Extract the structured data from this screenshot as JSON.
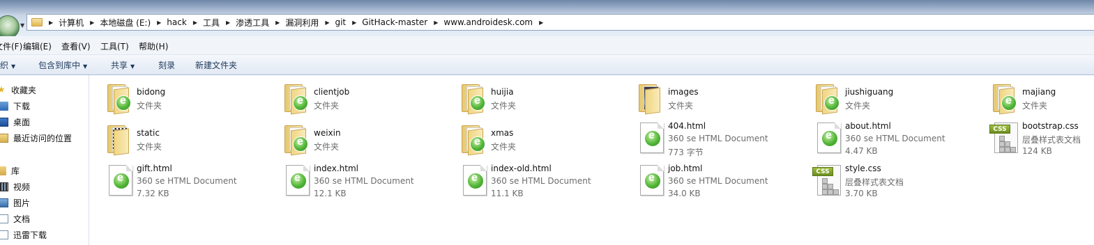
{
  "address_bar": {
    "breadcrumbs": [
      "计算机",
      "本地磁盘 (E:)",
      "hack",
      "工具",
      "渗透工具",
      "漏洞利用",
      "git",
      "GitHack-master",
      "www.androidesk.com"
    ]
  },
  "menu": [
    "文件(F)",
    "编辑(E)",
    "查看(V)",
    "工具(T)",
    "帮助(H)"
  ],
  "command_bar": {
    "organize": "组织",
    "include": "包含到库中",
    "share": "共享",
    "burn": "刻录",
    "new_folder": "新建文件夹"
  },
  "nav": {
    "favorites": [
      {
        "label": "收藏夹",
        "icon": "star-icon"
      },
      {
        "label": "下载",
        "icon": "download-folder-icon"
      },
      {
        "label": "桌面",
        "icon": "desktop-icon"
      },
      {
        "label": "最近访问的位置",
        "icon": "recent-places-icon"
      }
    ],
    "libraries": [
      {
        "label": "库",
        "icon": "library-icon"
      },
      {
        "label": "视频",
        "icon": "video-icon"
      },
      {
        "label": "图片",
        "icon": "pictures-icon"
      },
      {
        "label": "文档",
        "icon": "documents-icon"
      },
      {
        "label": "迅雷下载",
        "icon": "thunder-download-icon"
      }
    ]
  },
  "files": [
    {
      "name": "bidong",
      "type": "文件夹",
      "kind": "folder"
    },
    {
      "name": "clientjob",
      "type": "文件夹",
      "kind": "folder"
    },
    {
      "name": "huijia",
      "type": "文件夹",
      "kind": "folder"
    },
    {
      "name": "images",
      "type": "文件夹",
      "kind": "folder-images"
    },
    {
      "name": "jiushiguang",
      "type": "文件夹",
      "kind": "folder"
    },
    {
      "name": "majiang",
      "type": "文件夹",
      "kind": "folder"
    },
    {
      "name": "static",
      "type": "文件夹",
      "kind": "folder-qr"
    },
    {
      "name": "weixin",
      "type": "文件夹",
      "kind": "folder"
    },
    {
      "name": "xmas",
      "type": "文件夹",
      "kind": "folder"
    },
    {
      "name": "404.html",
      "type": "360 se HTML Document",
      "size": "773 字节",
      "kind": "html"
    },
    {
      "name": "about.html",
      "type": "360 se HTML Document",
      "size": "4.47 KB",
      "kind": "html"
    },
    {
      "name": "bootstrap.css",
      "type": "层叠样式表文档",
      "size": "124 KB",
      "kind": "css"
    },
    {
      "name": "gift.html",
      "type": "360 se HTML Document",
      "size": "7.32 KB",
      "kind": "html"
    },
    {
      "name": "index.html",
      "type": "360 se HTML Document",
      "size": "12.1 KB",
      "kind": "html"
    },
    {
      "name": "index-old.html",
      "type": "360 se HTML Document",
      "size": "11.1 KB",
      "kind": "html"
    },
    {
      "name": "job.html",
      "type": "360 se HTML Document",
      "size": "34.0 KB",
      "kind": "html"
    },
    {
      "name": "style.css",
      "type": "层叠样式表文档",
      "size": "3.70 KB",
      "kind": "css"
    }
  ]
}
